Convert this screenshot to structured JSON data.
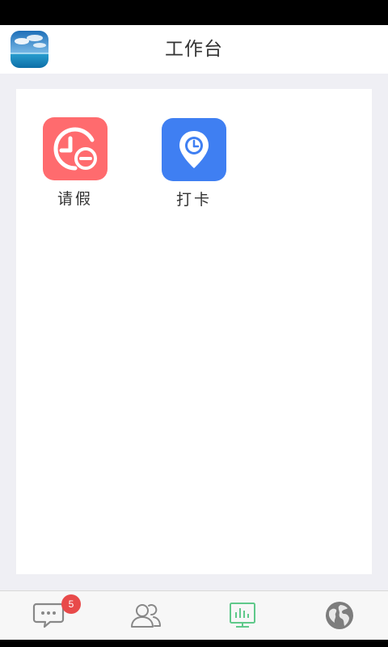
{
  "header": {
    "title": "工作台",
    "avatar_icon": "landscape-avatar-icon"
  },
  "apps": [
    {
      "label": "请假",
      "icon": "clock-minus-icon",
      "color": "#ff6b6e"
    },
    {
      "label": "打卡",
      "icon": "clock-location-pin-icon",
      "color": "#3f7ff2"
    }
  ],
  "tabs": [
    {
      "name": "messages",
      "icon": "chat-bubble-icon",
      "badge": "5",
      "active": false
    },
    {
      "name": "contacts",
      "icon": "people-icon",
      "active": false
    },
    {
      "name": "workbench",
      "icon": "bar-chart-board-icon",
      "active": true
    },
    {
      "name": "discover",
      "icon": "globe-icon",
      "active": false
    }
  ],
  "colors": {
    "accent": "#5fc98a",
    "badge": "#e84a4a",
    "background": "#efeff4"
  }
}
